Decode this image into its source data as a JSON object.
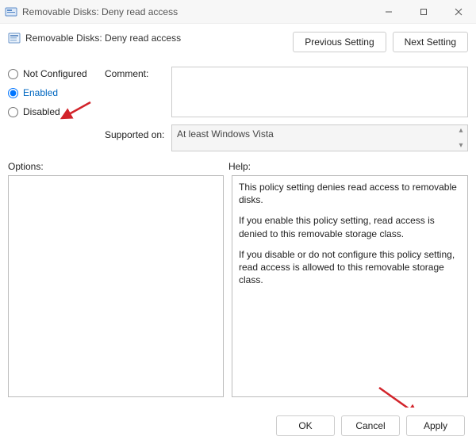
{
  "window": {
    "title": "Removable Disks: Deny read access",
    "minimize_name": "minimize-button",
    "maximize_name": "maximize-button",
    "close_name": "close-button"
  },
  "policy": {
    "name": "Removable Disks: Deny read access"
  },
  "nav": {
    "previous": "Previous Setting",
    "next": "Next Setting"
  },
  "state": {
    "not_configured_label": "Not Configured",
    "enabled_label": "Enabled",
    "disabled_label": "Disabled",
    "selected": "enabled"
  },
  "labels": {
    "comment": "Comment:",
    "supported_on": "Supported on:",
    "options": "Options:",
    "help": "Help:"
  },
  "supported_on": "At least Windows Vista",
  "help": {
    "p1": "This policy setting denies read access to removable disks.",
    "p2": "If you enable this policy setting, read access is denied to this removable storage class.",
    "p3": "If you disable or do not configure this policy setting, read access is allowed to this removable storage class."
  },
  "footer": {
    "ok": "OK",
    "cancel": "Cancel",
    "apply": "Apply"
  },
  "colors": {
    "annotation_arrow": "#d2232a",
    "accent": "#0067c0"
  }
}
